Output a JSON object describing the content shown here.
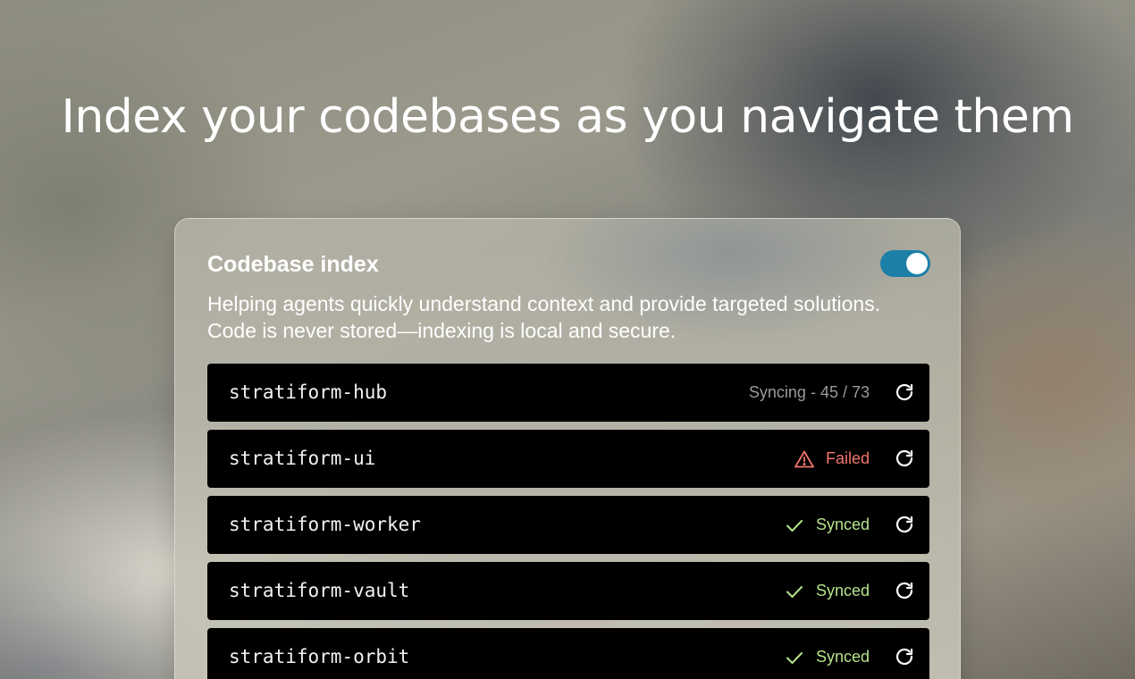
{
  "headline": "Index your codebases as you navigate them",
  "panel": {
    "title": "Codebase index",
    "toggle_enabled": true,
    "description": "Helping agents quickly understand context and provide targeted solutions. Code is never stored—indexing is local and secure."
  },
  "colors": {
    "toggle_on": "#1b7fa6",
    "syncing_text": "#9a9a9a",
    "failed": "#f2766d",
    "synced": "#b5e38a"
  },
  "repos": [
    {
      "name": "stratiform-hub",
      "status": "Syncing - 45 / 73",
      "state": "syncing",
      "icon": "none",
      "refresh_icon": "refresh-icon"
    },
    {
      "name": "stratiform-ui",
      "status": "Failed",
      "state": "failed",
      "icon": "warning-icon",
      "refresh_icon": "refresh-icon"
    },
    {
      "name": "stratiform-worker",
      "status": "Synced",
      "state": "synced",
      "icon": "check-icon",
      "refresh_icon": "refresh-icon"
    },
    {
      "name": "stratiform-vault",
      "status": "Synced",
      "state": "synced",
      "icon": "check-icon",
      "refresh_icon": "refresh-icon"
    },
    {
      "name": "stratiform-orbit",
      "status": "Synced",
      "state": "synced",
      "icon": "check-icon",
      "refresh_icon": "refresh-icon"
    }
  ]
}
